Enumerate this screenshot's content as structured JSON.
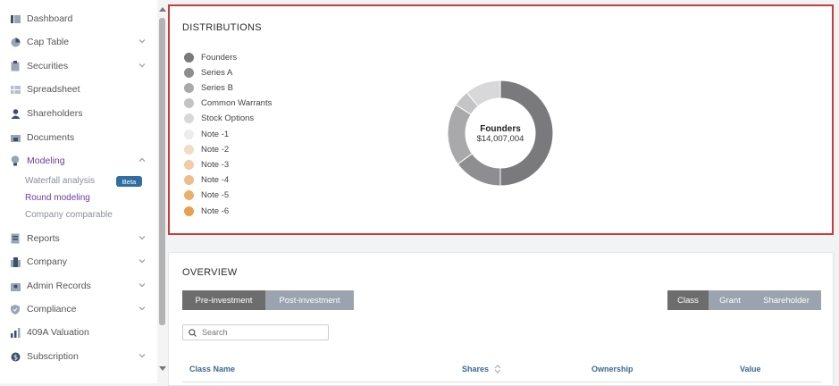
{
  "sidebar": {
    "items": [
      {
        "label": "Dashboard",
        "icon": "dashboard-icon",
        "chevron": false
      },
      {
        "label": "Cap Table",
        "icon": "pie-chart-icon",
        "chevron": true
      },
      {
        "label": "Securities",
        "icon": "clipboard-icon",
        "chevron": true
      },
      {
        "label": "Spreadsheet",
        "icon": "spreadsheet-icon",
        "chevron": false
      },
      {
        "label": "Shareholders",
        "icon": "person-icon",
        "chevron": false
      },
      {
        "label": "Documents",
        "icon": "folder-icon",
        "chevron": false
      },
      {
        "label": "Modeling",
        "icon": "lightbulb-icon",
        "chevron": true,
        "expanded": true
      },
      {
        "label": "Reports",
        "icon": "report-icon",
        "chevron": true
      },
      {
        "label": "Company",
        "icon": "building-icon",
        "chevron": true
      },
      {
        "label": "Admin Records",
        "icon": "admin-icon",
        "chevron": true
      },
      {
        "label": "Compliance",
        "icon": "shield-icon",
        "chevron": true
      },
      {
        "label": "409A Valuation",
        "icon": "valuation-icon",
        "chevron": false
      },
      {
        "label": "Subscription",
        "icon": "dollar-icon",
        "chevron": true
      }
    ],
    "modeling_sub": [
      {
        "label": "Waterfall analysis",
        "active": false
      },
      {
        "label": "Round modeling",
        "active": true
      },
      {
        "label": "Company comparable",
        "active": false
      }
    ],
    "beta_badge": "Beta"
  },
  "distributions": {
    "title": "DISTRIBUTIONS",
    "legend": [
      {
        "label": "Founders",
        "color": "#7a7a7c"
      },
      {
        "label": "Series A",
        "color": "#8e8e90"
      },
      {
        "label": "Series B",
        "color": "#a9a9ab"
      },
      {
        "label": "Common Warrants",
        "color": "#c4c4c6"
      },
      {
        "label": "Stock Options",
        "color": "#d8d8da"
      },
      {
        "label": "Note -1",
        "color": "#ececec"
      },
      {
        "label": "Note -2",
        "color": "#f1dcc6"
      },
      {
        "label": "Note -3",
        "color": "#efcda6"
      },
      {
        "label": "Note -4",
        "color": "#ecbe88"
      },
      {
        "label": "Note -5",
        "color": "#e9b06c"
      },
      {
        "label": "Note -6",
        "color": "#e6a04e"
      }
    ],
    "donut": {
      "center_name": "Founders",
      "center_value": "$14,007,004",
      "slices": [
        {
          "label": "Founders",
          "value": 50,
          "color": "#7a7a7c"
        },
        {
          "label": "Series A",
          "value": 15,
          "color": "#8e8e90"
        },
        {
          "label": "Series B",
          "value": 19,
          "color": "#a9a9ab"
        },
        {
          "label": "Common Warrants",
          "value": 5,
          "color": "#c4c4c6"
        },
        {
          "label": "Stock Options",
          "value": 11,
          "color": "#d8d8da"
        }
      ]
    }
  },
  "overview": {
    "title": "OVERVIEW",
    "investment_toggle": [
      "Pre-investment",
      "Post-investment"
    ],
    "investment_selected": "Pre-investment",
    "view_toggle": [
      "Class",
      "Grant",
      "Shareholder"
    ],
    "view_selected": "Class",
    "search_placeholder": "Search",
    "columns": [
      "Class Name",
      "Shares",
      "Ownership",
      "Value"
    ]
  }
}
